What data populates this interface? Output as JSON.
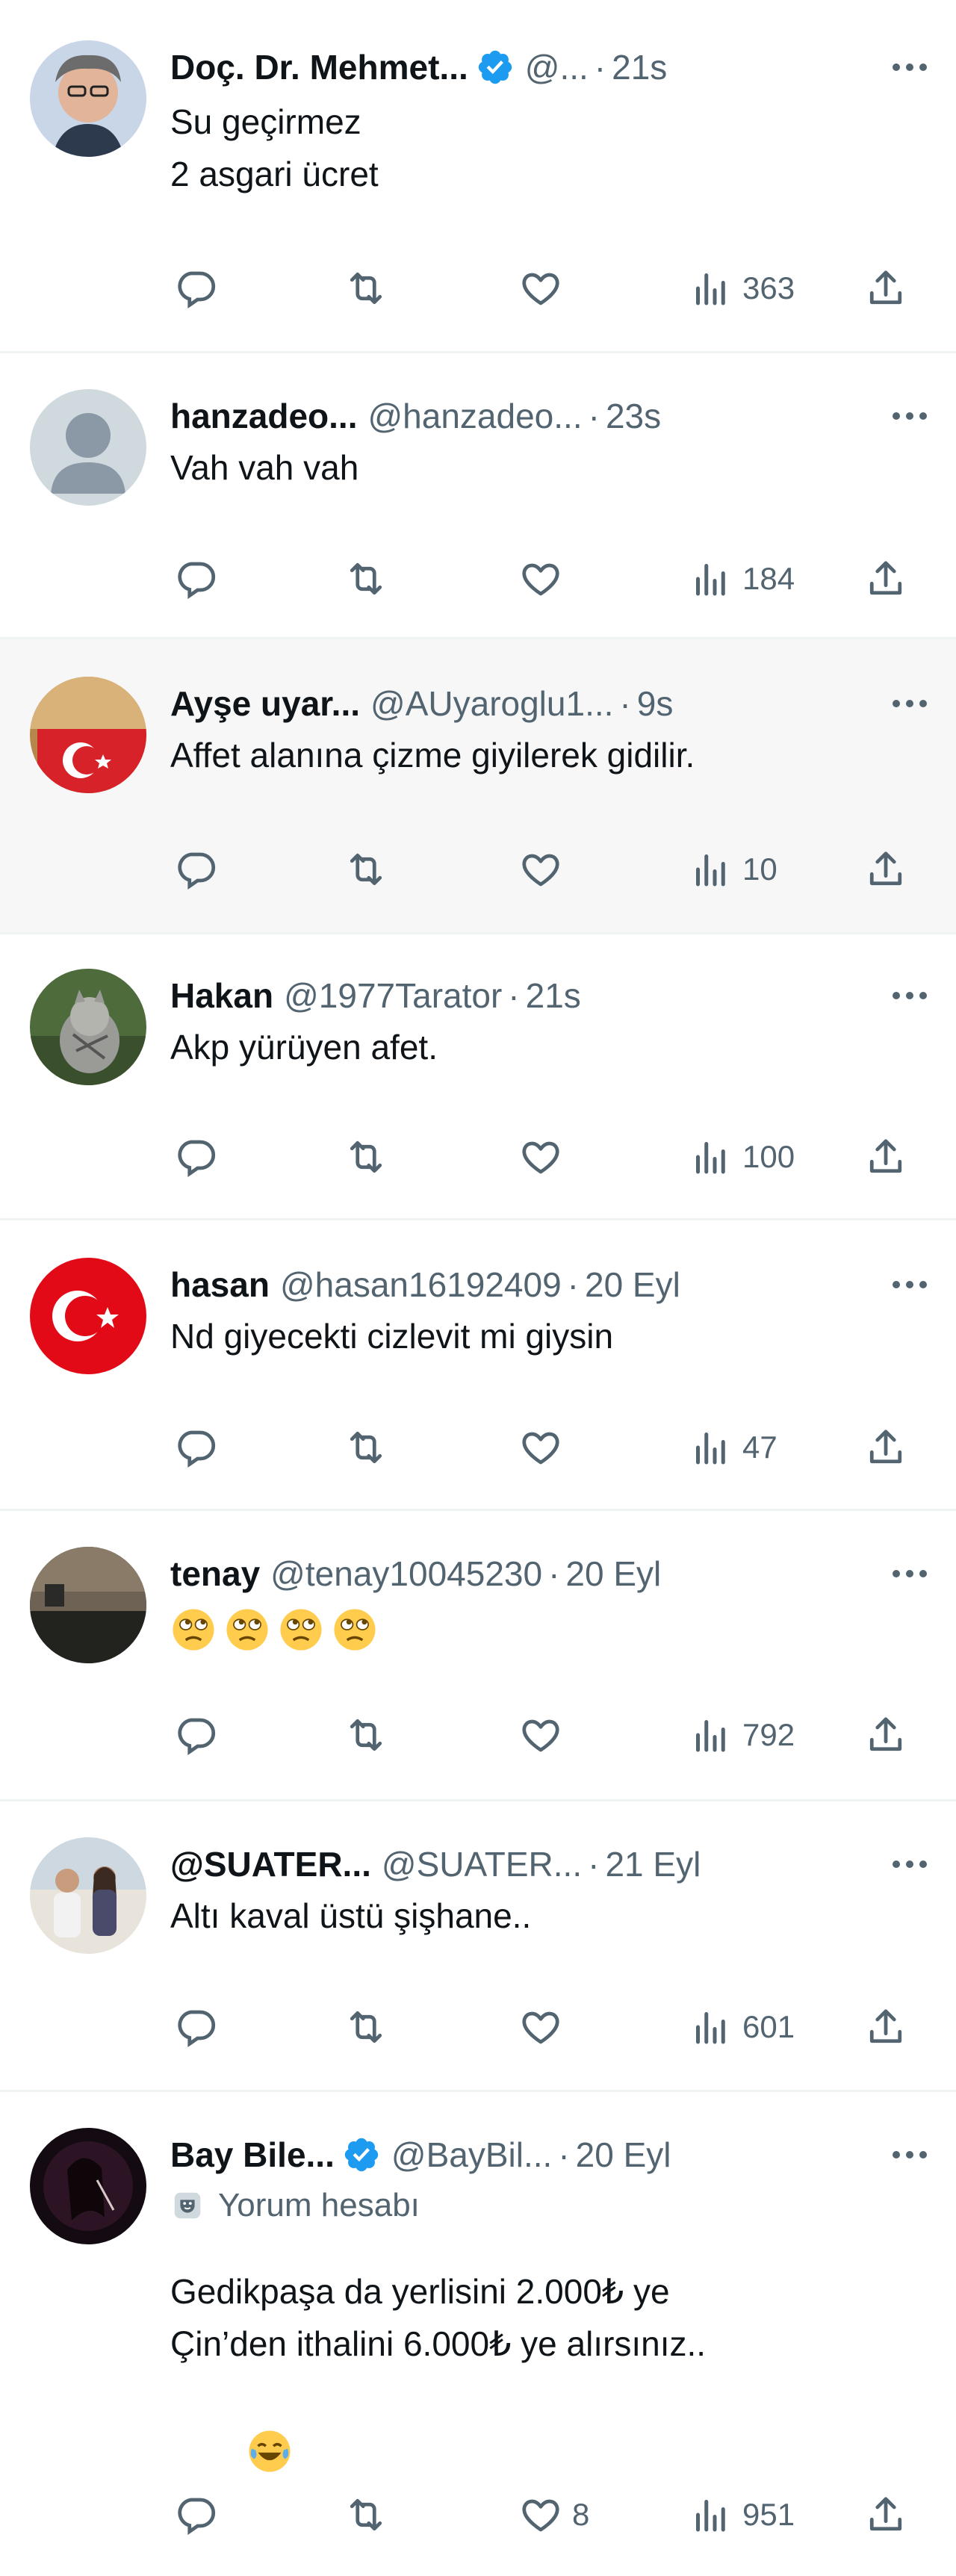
{
  "colors": {
    "text": "#0f1419",
    "secondary": "#536471",
    "verified": "#1d9bf0",
    "divider": "#eff3f4",
    "highlight_bg": "#f7f7f7"
  },
  "tweets": [
    {
      "name": "Doç. Dr. Mehmet...",
      "verified": true,
      "handle": "@...",
      "time": "21s",
      "lines": [
        "Su geçirmez",
        "2 asgari ücret"
      ],
      "views": "363",
      "likes": ""
    },
    {
      "name": "hanzadeo...",
      "verified": false,
      "handle": "@hanzadeo...",
      "time": "23s",
      "lines": [
        "Vah vah vah"
      ],
      "views": "184",
      "likes": ""
    },
    {
      "name": "Ayşe uyar...",
      "verified": false,
      "handle": "@AUyaroglu1...",
      "time": "9s",
      "lines": [
        "Affet alanına çizme giyilerek gidilir."
      ],
      "views": "10",
      "likes": ""
    },
    {
      "name": "Hakan",
      "verified": false,
      "handle": "@1977Tarator",
      "time": "21s",
      "lines": [
        "Akp yürüyen afet."
      ],
      "views": "100",
      "likes": ""
    },
    {
      "name": "hasan",
      "verified": false,
      "handle": "@hasan16192409",
      "time": "20 Eyl",
      "lines": [
        "Nd giyecekti cizlevit mi giysin"
      ],
      "views": "47",
      "likes": ""
    },
    {
      "name": "tenay",
      "verified": false,
      "handle": "@tenay10045230",
      "time": "20 Eyl",
      "emoji_line": [
        "rolling-eyes-emoji",
        "rolling-eyes-emoji",
        "rolling-eyes-emoji",
        "rolling-eyes-emoji"
      ],
      "lines": [],
      "views": "792",
      "likes": ""
    },
    {
      "name": "@SUATER...",
      "verified": false,
      "handle": "@SUATER...",
      "time": "21 Eyl",
      "lines": [
        "Altı kaval üstü şişhane.."
      ],
      "views": "601",
      "likes": ""
    },
    {
      "name": "Bay Bile...",
      "verified": true,
      "handle": "@BayBil...",
      "time": "20 Eyl",
      "label": "Yorum hesabı",
      "lines": [
        "Gedikpaşa da yerlisini 2.000₺ ye",
        "Çin’den ithalini 6.000₺ ye alırsınız.."
      ],
      "trailing_emoji": "laughing-tears-emoji",
      "views": "951",
      "likes": "8"
    }
  ]
}
